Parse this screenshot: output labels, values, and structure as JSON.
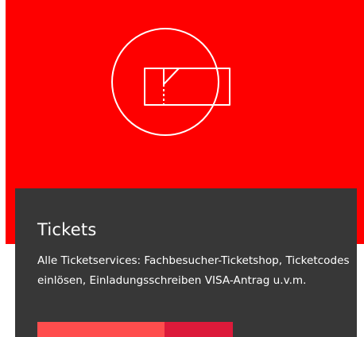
{
  "card": {
    "title": "Tickets",
    "description": "Alle Ticketservices: Fachbesucher-Ticketshop, Ticketcodes einlösen, Einladungsschreiben VISA-Antrag u.v.m.",
    "icon": "ticket-icon",
    "colors": {
      "hero_background": "#fe0000",
      "panel_background": "#373737",
      "text": "#ffffff",
      "button_primary": "#ff4d4d",
      "button_secondary": "#dc1a3a"
    }
  }
}
